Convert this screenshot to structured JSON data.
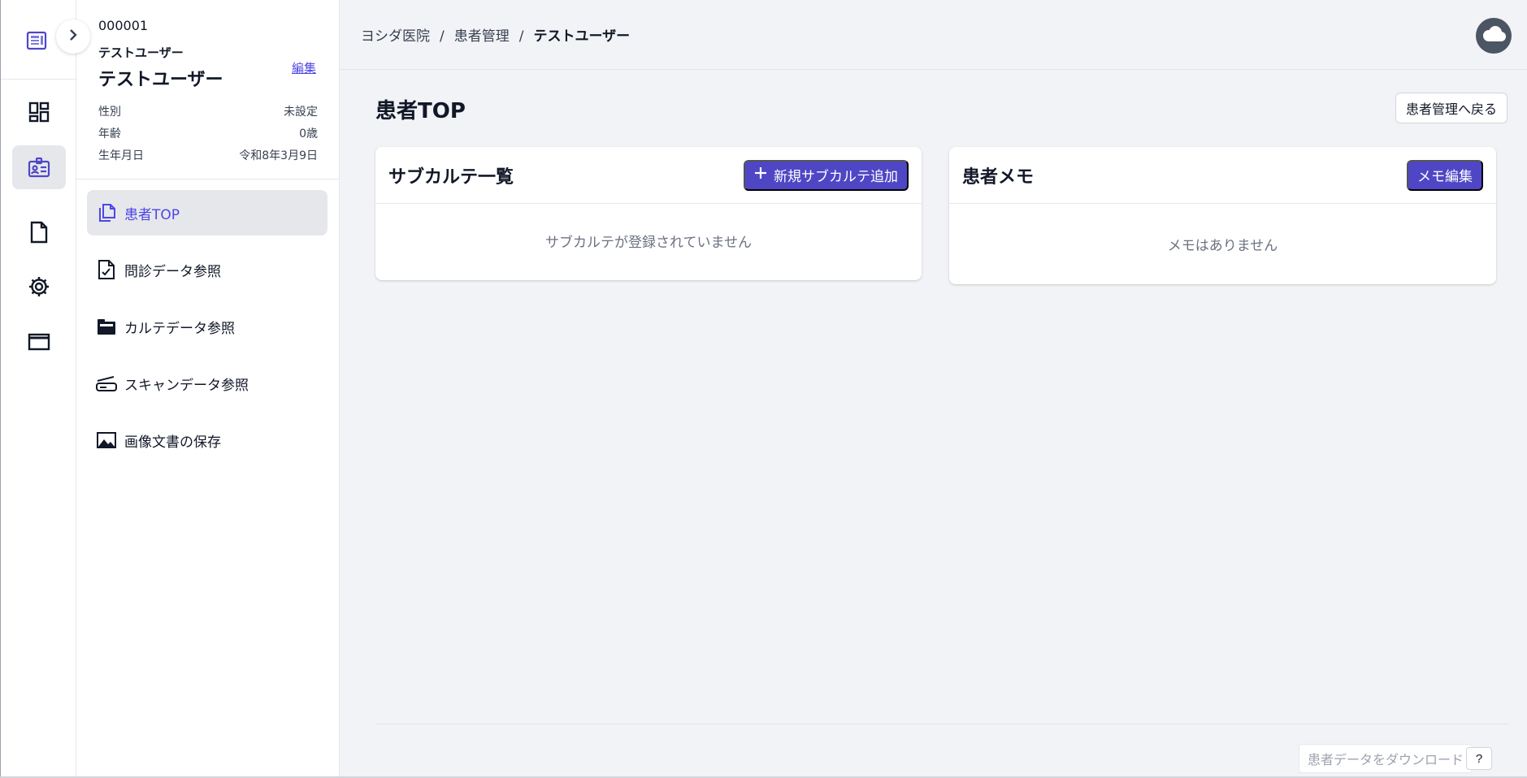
{
  "patient": {
    "id": "000001",
    "kana": "テストユーザー",
    "name": "テストユーザー",
    "edit_label": "編集",
    "fields": [
      {
        "label": "性別",
        "value": "未設定"
      },
      {
        "label": "年齢",
        "value": "0歳"
      },
      {
        "label": "生年月日",
        "value": "令和8年3月9日"
      }
    ]
  },
  "nav": {
    "items": [
      {
        "label": "患者TOP",
        "icon": "copy-icon",
        "active": true
      },
      {
        "label": "問診データ参照",
        "icon": "document-check-icon",
        "active": false
      },
      {
        "label": "カルテデータ参照",
        "icon": "folder-icon",
        "active": false
      },
      {
        "label": "スキャンデータ参照",
        "icon": "scanner-icon",
        "active": false
      },
      {
        "label": "画像文書の保存",
        "icon": "image-icon",
        "active": false
      }
    ]
  },
  "rail": {
    "items": [
      "dashboard-icon",
      "patient-id-icon",
      "file-icon",
      "gear-icon",
      "window-icon"
    ],
    "active": "patient-id-icon"
  },
  "breadcrumb": [
    "ヨシダ医院",
    "患者管理",
    "テストユーザー"
  ],
  "page": {
    "title": "患者TOP",
    "back_label": "患者管理へ戻る"
  },
  "subkarte": {
    "title": "サブカルテ一覧",
    "add_label": "新規サブカルテ追加",
    "empty_text": "サブカルテが登録されていません"
  },
  "memo": {
    "title": "患者メモ",
    "edit_label": "メモ編集",
    "empty_text": "メモはありません"
  },
  "footer": {
    "download_label": "患者データをダウンロード",
    "help_label": "?"
  },
  "colors": {
    "accent": "#4f46c6",
    "main_bg": "#f2f3f6",
    "active_nav_bg": "#e5e7eb"
  }
}
